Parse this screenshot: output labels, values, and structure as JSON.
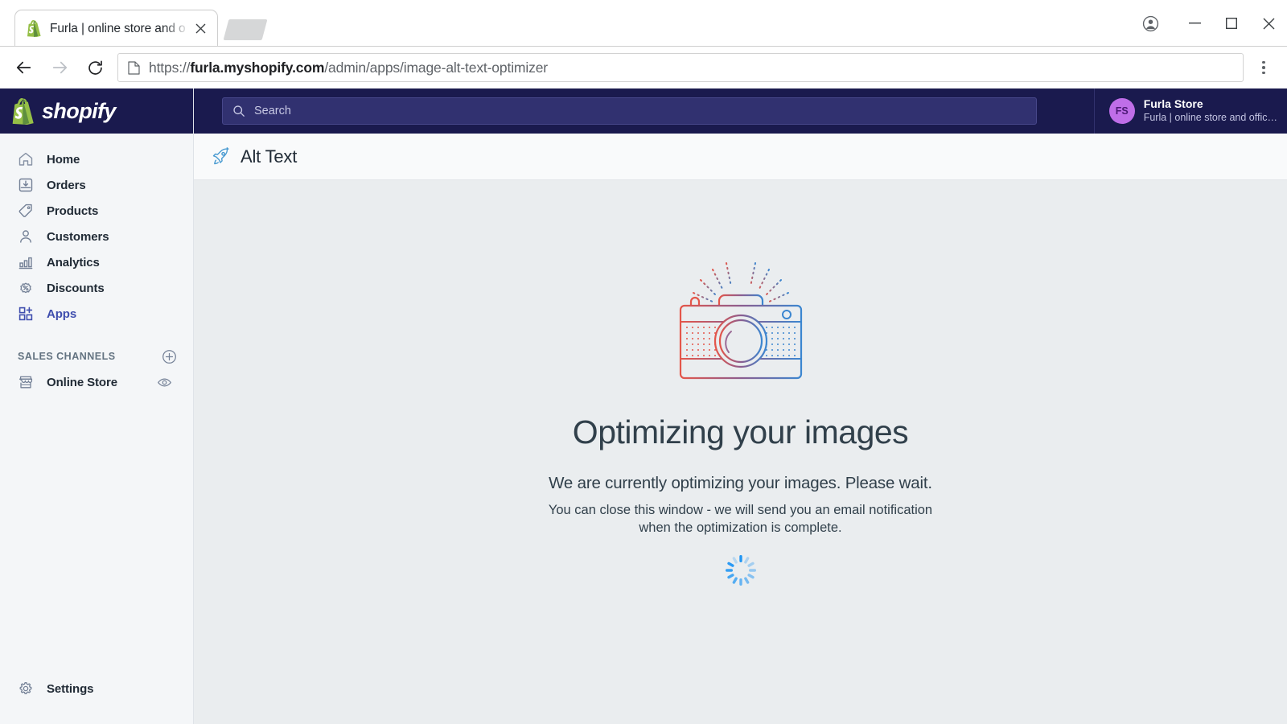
{
  "browser": {
    "tab": {
      "title": "Furla | online store and o",
      "favicon_icon": "shopify-bag-icon",
      "close_icon": "close-icon"
    },
    "ghost_tab": "new-tab-placeholder",
    "window_controls": {
      "profile_icon": "profile-icon",
      "minimize_icon": "minimize-icon",
      "maximize_icon": "maximize-icon",
      "close_icon": "close-icon"
    },
    "toolbar": {
      "back_icon": "back-arrow-icon",
      "forward_icon": "forward-arrow-icon",
      "reload_icon": "reload-icon",
      "page_icon": "page-document-icon",
      "menu_icon": "three-dots-menu-icon",
      "url_scheme": "https://",
      "url_host": "furla.myshopify.com",
      "url_path": "/admin/apps/image-alt-text-optimizer"
    }
  },
  "sidebar": {
    "logo_word": "shopify",
    "logo_icon": "shopify-bag-icon",
    "items": [
      {
        "label": "Home",
        "icon": "home-icon",
        "active": false
      },
      {
        "label": "Orders",
        "icon": "orders-inbox-icon",
        "active": false
      },
      {
        "label": "Products",
        "icon": "tag-icon",
        "active": false
      },
      {
        "label": "Customers",
        "icon": "person-icon",
        "active": false
      },
      {
        "label": "Analytics",
        "icon": "bar-chart-icon",
        "active": false
      },
      {
        "label": "Discounts",
        "icon": "discount-badge-icon",
        "active": false
      },
      {
        "label": "Apps",
        "icon": "apps-grid-plus-icon",
        "active": true
      }
    ],
    "sales_channels": {
      "title": "SALES CHANNELS",
      "add_icon": "plus-circle-icon",
      "channels": [
        {
          "label": "Online Store",
          "icon": "storefront-icon",
          "action_icon": "eye-icon"
        }
      ]
    },
    "footer": {
      "label": "Settings",
      "icon": "gear-icon"
    }
  },
  "topbar": {
    "search": {
      "placeholder": "Search",
      "icon": "search-icon",
      "value": ""
    },
    "store": {
      "initials": "FS",
      "name": "Furla Store",
      "subtitle": "Furla | online store and offic…"
    }
  },
  "app_header": {
    "title": "Alt Text",
    "icon": "rocket-icon"
  },
  "content": {
    "illustration_icon": "camera-with-flash-illustration",
    "headline": "Optimizing your images",
    "subtitle": "We are currently optimizing your images. Please wait.",
    "note": "You can close this window - we will send you an email notification when the optimization is complete.",
    "spinner_icon": "loading-spinner-icon"
  },
  "colors": {
    "shopify_navy": "#1a1a4e",
    "search_field": "#313170",
    "accent_purple": "#3f4eae",
    "avatar_purple": "#bf6ee8",
    "content_bg": "#eaedef",
    "illustration_red": "#e4564a",
    "illustration_blue": "#3b86d0",
    "spinner_blue": "#2196f3"
  }
}
